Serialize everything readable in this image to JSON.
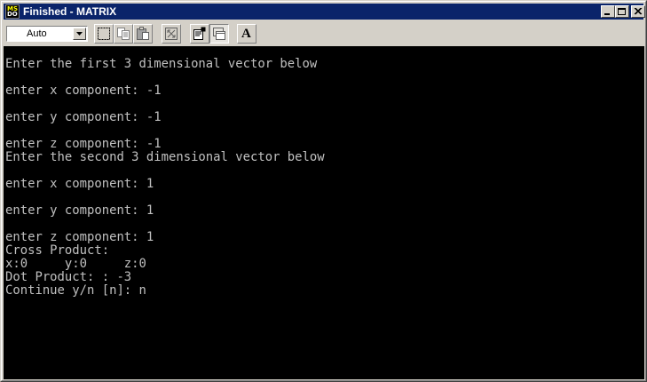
{
  "window": {
    "title": "Finished - MATRIX"
  },
  "icon_letters": {
    "top": "MS",
    "bottom": "DO"
  },
  "toolbar": {
    "font_size_value": "Auto",
    "font_button_label": "A",
    "tools": [
      "mark-icon",
      "copy-icon",
      "paste-icon",
      "fullscreen-icon",
      "properties-icon",
      "background-icon",
      "font-icon"
    ]
  },
  "console": {
    "lines": [
      "Enter the first 3 dimensional vector below",
      "",
      "enter x component: -1",
      "",
      "enter y component: -1",
      "",
      "enter z component: -1",
      "Enter the second 3 dimensional vector below",
      "",
      "enter x component: 1",
      "",
      "enter y component: 1",
      "",
      "enter z component: 1",
      "Cross Product:",
      "x:0     y:0     z:0",
      "Dot Product: : -3",
      "Continue y/n [n]: n"
    ]
  },
  "colors": {
    "titlebar": "#0a246a",
    "console_bg": "#000000",
    "console_text": "#c0c0c0",
    "chrome": "#d4d0c8"
  }
}
